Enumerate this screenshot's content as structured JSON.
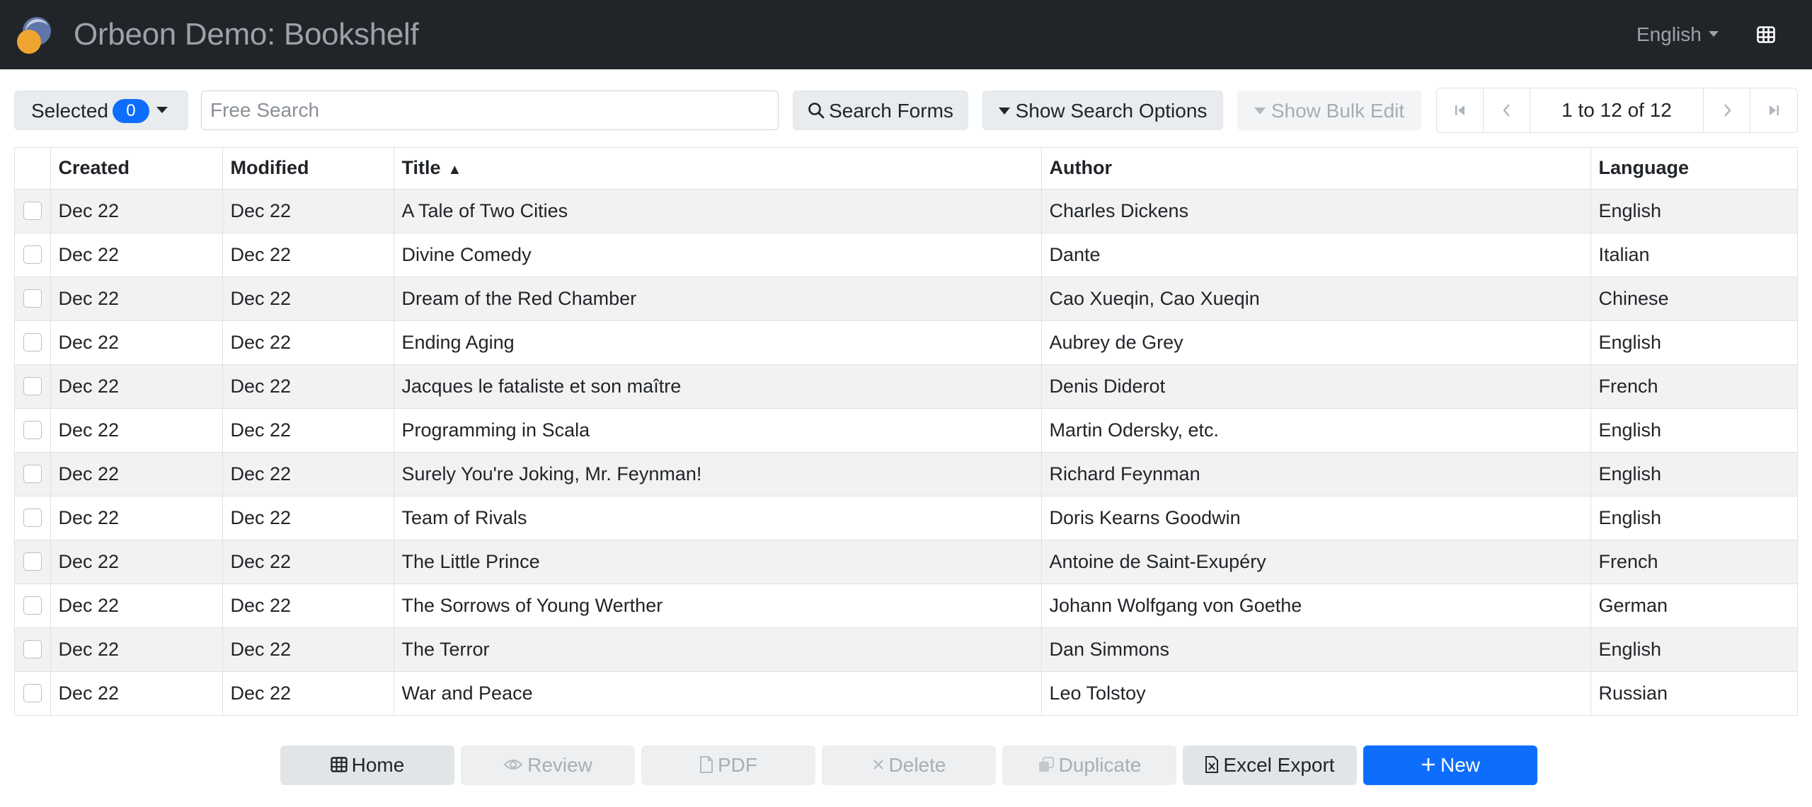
{
  "navbar": {
    "title": "Orbeon Demo: Bookshelf",
    "language": "English",
    "logo_icon": "orbeon-logo",
    "grid_icon": "table-grid-icon"
  },
  "toolbar": {
    "selected_label": "Selected",
    "selected_count": "0",
    "search_placeholder": "Free Search",
    "search_value": "",
    "search_button": "Search Forms",
    "search_options_button": "Show Search Options",
    "bulk_edit_button": "Show Bulk Edit"
  },
  "pager": {
    "info": "1 to 12 of 12"
  },
  "table": {
    "headers": [
      "Created",
      "Modified",
      "Title",
      "Author",
      "Language"
    ],
    "sort_indicator": "▲",
    "rows": [
      {
        "created": "Dec 22",
        "modified": "Dec 22",
        "title": "A Tale of Two Cities",
        "author": "Charles Dickens",
        "language": "English"
      },
      {
        "created": "Dec 22",
        "modified": "Dec 22",
        "title": "Divine Comedy",
        "author": "Dante",
        "language": "Italian"
      },
      {
        "created": "Dec 22",
        "modified": "Dec 22",
        "title": "Dream of the Red Chamber",
        "author": "Cao Xueqin, Cao Xueqin",
        "language": "Chinese"
      },
      {
        "created": "Dec 22",
        "modified": "Dec 22",
        "title": "Ending Aging",
        "author": "Aubrey de Grey",
        "language": "English"
      },
      {
        "created": "Dec 22",
        "modified": "Dec 22",
        "title": "Jacques le fataliste et son maître",
        "author": "Denis Diderot",
        "language": "French"
      },
      {
        "created": "Dec 22",
        "modified": "Dec 22",
        "title": "Programming in Scala",
        "author": "Martin Odersky, etc.",
        "language": "English"
      },
      {
        "created": "Dec 22",
        "modified": "Dec 22",
        "title": "Surely You're Joking, Mr. Feynman!",
        "author": "Richard Feynman",
        "language": "English"
      },
      {
        "created": "Dec 22",
        "modified": "Dec 22",
        "title": "Team of Rivals",
        "author": "Doris Kearns Goodwin",
        "language": "English"
      },
      {
        "created": "Dec 22",
        "modified": "Dec 22",
        "title": "The Little Prince",
        "author": "Antoine de Saint-Exupéry",
        "language": "French"
      },
      {
        "created": "Dec 22",
        "modified": "Dec 22",
        "title": "The Sorrows of Young Werther",
        "author": "Johann Wolfgang von Goethe",
        "language": "German"
      },
      {
        "created": "Dec 22",
        "modified": "Dec 22",
        "title": "The Terror",
        "author": "Dan Simmons",
        "language": "English"
      },
      {
        "created": "Dec 22",
        "modified": "Dec 22",
        "title": "War and Peace",
        "author": "Leo Tolstoy",
        "language": "Russian"
      }
    ]
  },
  "actions": {
    "home": "Home",
    "review": "Review",
    "pdf": "PDF",
    "delete": "Delete",
    "duplicate": "Duplicate",
    "excel_export": "Excel Export",
    "new": "New"
  },
  "colors": {
    "navbar_bg": "#212529",
    "primary": "#0d6efd",
    "row_stripe": "#f2f2f2"
  }
}
